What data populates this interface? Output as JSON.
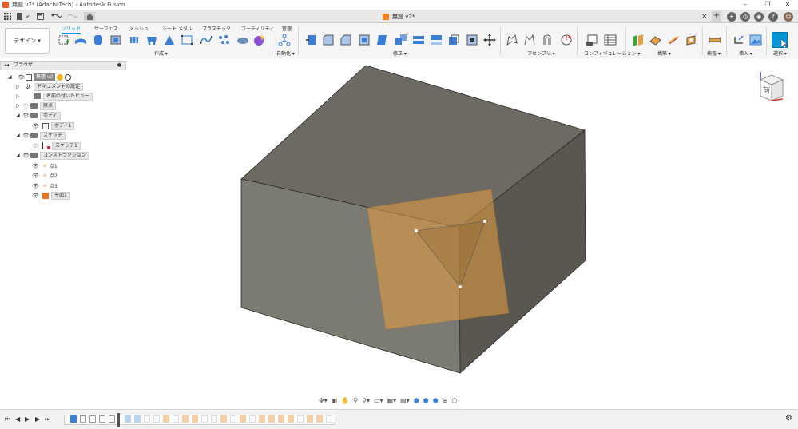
{
  "window": {
    "title": "無題 v2* (Adachi-Tech) - Autodesk Fusion",
    "minimize": "–",
    "maximize": "❐",
    "close": "✕"
  },
  "document_tab": {
    "label": "無題 v2*",
    "close": "×",
    "add": "+"
  },
  "workspace": {
    "label": "デザイン ▾"
  },
  "ribbon": {
    "tabs": [
      {
        "label": "ソリッド",
        "active": true
      },
      {
        "label": "サーフェス",
        "active": false
      },
      {
        "label": "メッシュ",
        "active": false
      },
      {
        "label": "シート メタル",
        "active": false
      },
      {
        "label": "プラスチック",
        "active": false
      },
      {
        "label": "ユーティリティ",
        "active": false
      },
      {
        "label": "管理",
        "active": false
      }
    ],
    "groups": [
      {
        "label": "作成 ▾"
      },
      {
        "label": "自動化 ▾"
      },
      {
        "label": "修正 ▾"
      },
      {
        "label": "アセンブリ ▾"
      },
      {
        "label": "コンフィギュレーション ▾"
      },
      {
        "label": "構築 ▾"
      },
      {
        "label": "検査 ▾"
      },
      {
        "label": "挿入 ▾"
      },
      {
        "label": "選択 ▾"
      }
    ]
  },
  "browser": {
    "title": "ブラウザ",
    "collapse": "◂◂",
    "items": [
      {
        "label": "無題 v2",
        "expanded": true
      },
      {
        "label": "ドキュメントの設定",
        "expanded": false
      },
      {
        "label": "名前の付いたビュー",
        "expanded": false
      },
      {
        "label": "原点",
        "expanded": false
      },
      {
        "label": "ボディ",
        "expanded": true
      },
      {
        "label": "ボディ1"
      },
      {
        "label": "スケッチ",
        "expanded": true
      },
      {
        "label": "スケッチ1"
      },
      {
        "label": "コンストラクション",
        "expanded": true
      },
      {
        "label": "点1"
      },
      {
        "label": "点2"
      },
      {
        "label": "点3"
      },
      {
        "label": "平面1"
      }
    ]
  },
  "viewcube": {
    "face_label": "前"
  },
  "colors": {
    "accent": "#0696d7",
    "body_front": "#7b7b72",
    "body_top": "#6c6a62",
    "body_right": "#5a5750",
    "plane": "#e8a040",
    "edge": "#2a2a2a"
  }
}
